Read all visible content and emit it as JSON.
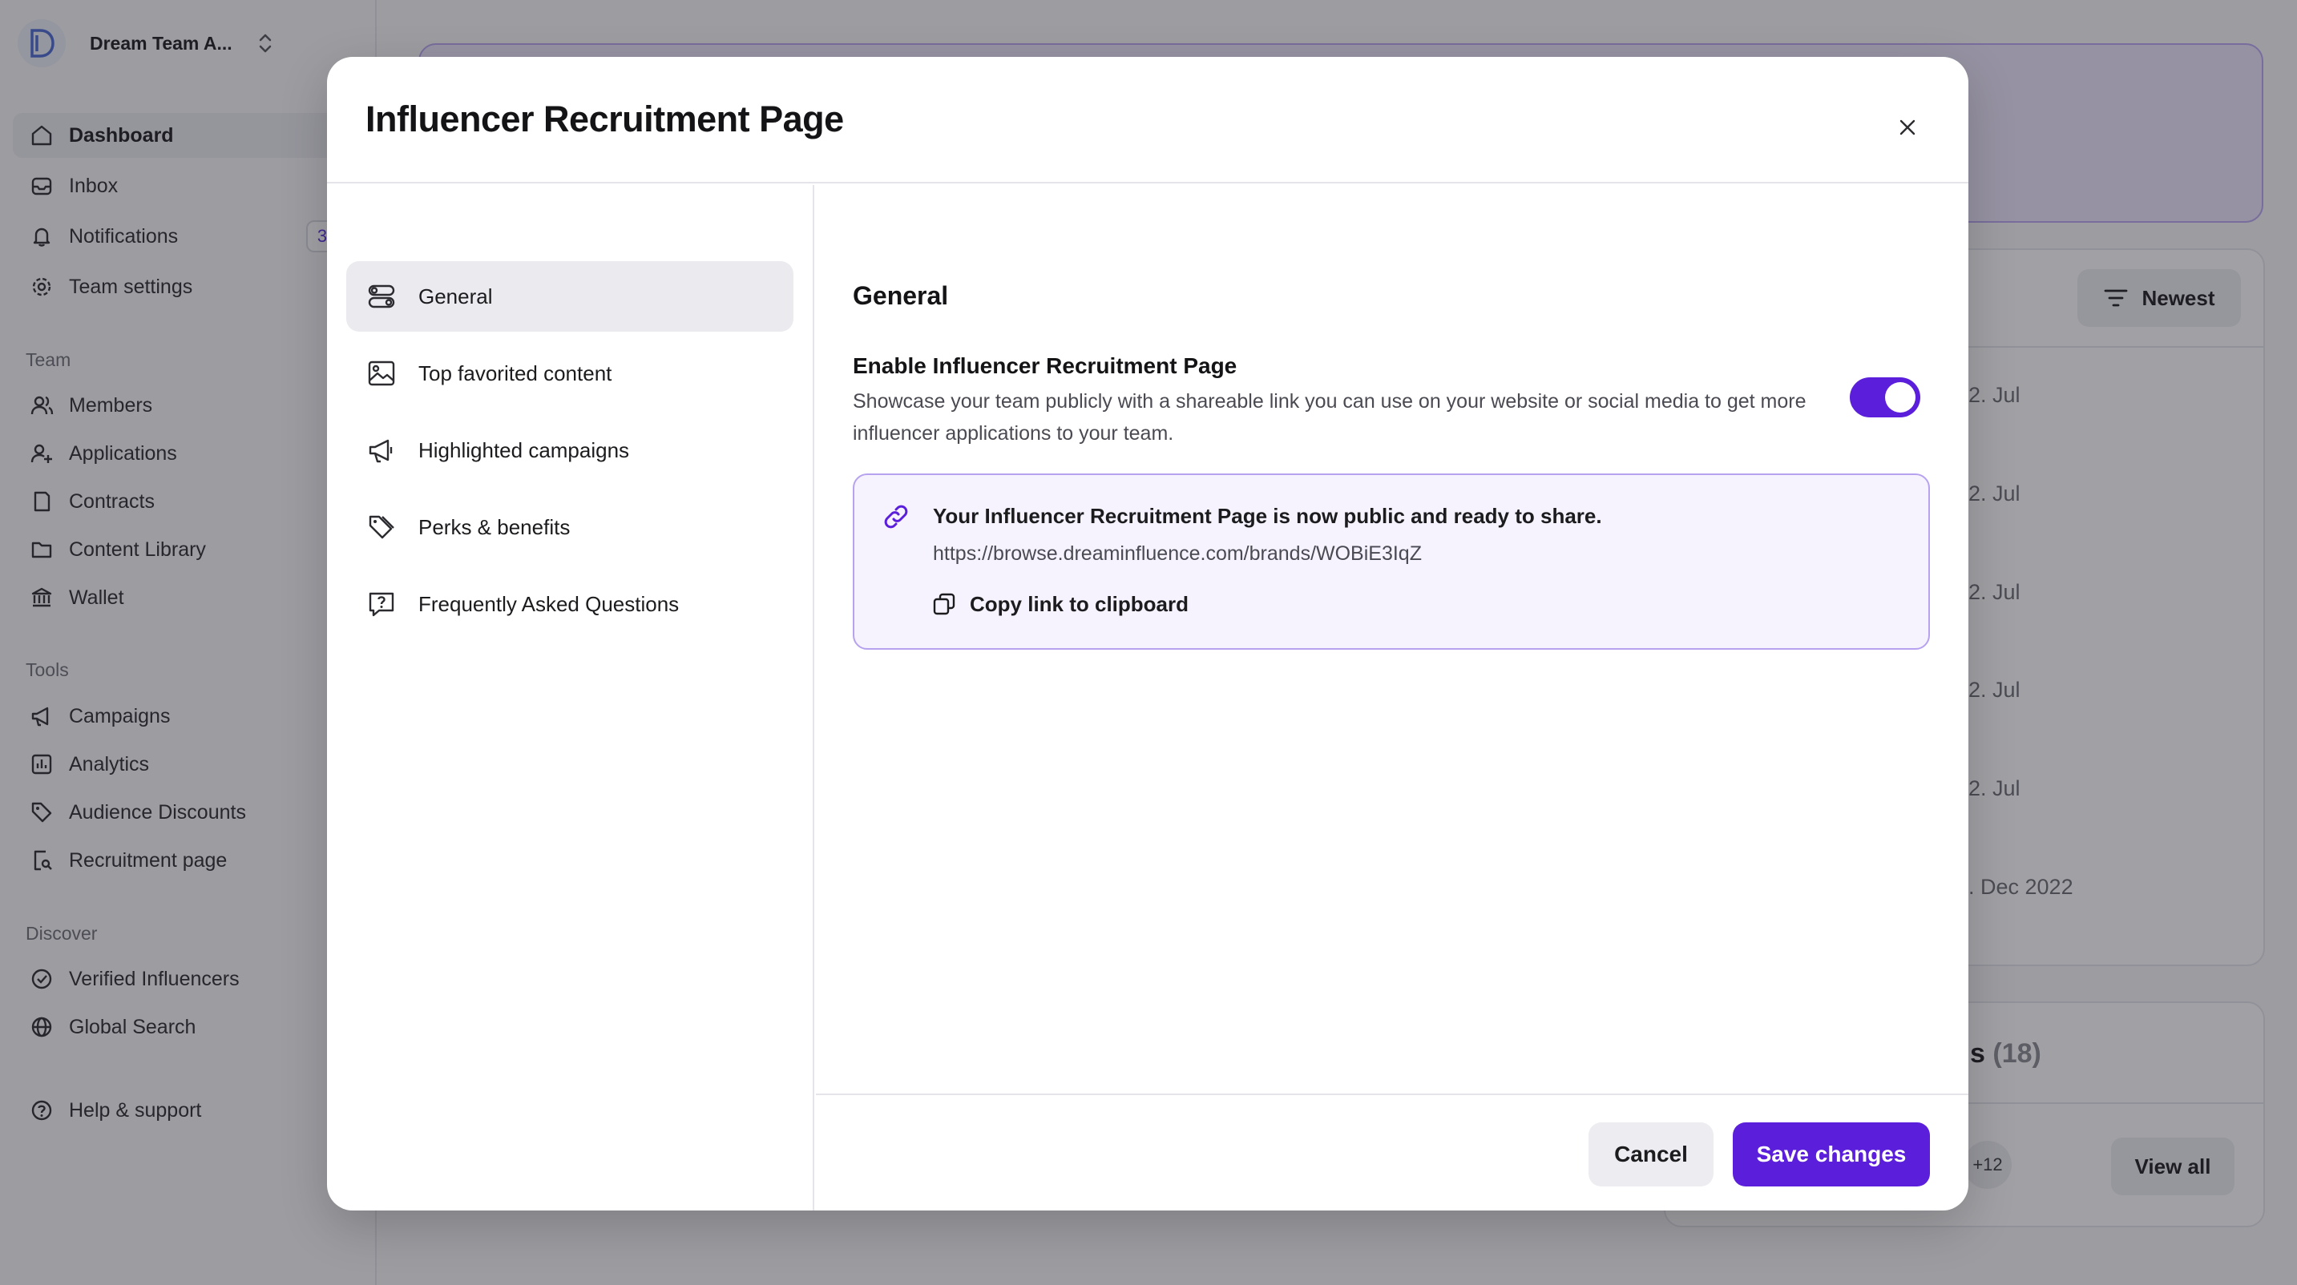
{
  "sidebar": {
    "team_name": "Dream Team A...",
    "team_logo_letter": "D",
    "nav": [
      {
        "label": "Dashboard",
        "icon": "home-icon",
        "active": true
      },
      {
        "label": "Inbox",
        "icon": "inbox-icon"
      },
      {
        "label": "Notifications",
        "icon": "bell-icon",
        "badge": "3"
      },
      {
        "label": "Team settings",
        "icon": "gear-icon"
      }
    ],
    "team_section": "Team",
    "team_items": [
      {
        "label": "Members",
        "icon": "users-icon"
      },
      {
        "label": "Applications",
        "icon": "user-add-icon"
      },
      {
        "label": "Contracts",
        "icon": "document-icon"
      },
      {
        "label": "Content Library",
        "icon": "folder-icon"
      },
      {
        "label": "Wallet",
        "icon": "bank-icon"
      }
    ],
    "tools_section": "Tools",
    "tools_items": [
      {
        "label": "Campaigns",
        "icon": "megaphone-icon"
      },
      {
        "label": "Analytics",
        "icon": "chart-icon"
      },
      {
        "label": "Audience Discounts",
        "icon": "tag-icon"
      },
      {
        "label": "Recruitment page",
        "icon": "page-search-icon"
      }
    ],
    "discover_section": "Discover",
    "discover_items": [
      {
        "label": "Verified Influencers",
        "icon": "check-circle-icon"
      },
      {
        "label": "Global Search",
        "icon": "globe-icon"
      }
    ],
    "help": {
      "label": "Help & support",
      "icon": "help-circle-icon"
    }
  },
  "background": {
    "sort_label": "Newest",
    "dates": [
      "2. Jul",
      "2. Jul",
      "2. Jul",
      "2. Jul",
      "2. Jul",
      ". Dec 2022"
    ],
    "card2_title_suffix": "s",
    "card2_count": "(18)",
    "more_count": "+12",
    "view_all_label": "View all"
  },
  "modal": {
    "title": "Influencer Recruitment Page",
    "nav": [
      {
        "label": "General",
        "icon": "toggles-icon",
        "active": true
      },
      {
        "label": "Top favorited content",
        "icon": "image-icon"
      },
      {
        "label": "Highlighted campaigns",
        "icon": "megaphone-icon"
      },
      {
        "label": "Perks & benefits",
        "icon": "tags-icon"
      },
      {
        "label": "Frequently Asked Questions",
        "icon": "question-bubble-icon"
      }
    ],
    "section_title": "General",
    "setting": {
      "title": "Enable Influencer Recruitment Page",
      "description": "Showcase your team publicly with a shareable link you can use on your website or social media to get more influencer applications to your team.",
      "enabled": true
    },
    "share": {
      "message": "Your Influencer Recruitment Page is now public and ready to share.",
      "url": "https://browse.dreaminfluence.com/brands/WOBiE3IqZ",
      "copy_label": "Copy link to clipboard"
    },
    "cancel_label": "Cancel",
    "save_label": "Save changes"
  },
  "colors": {
    "accent": "#5b1fdc",
    "share_bg": "#f6f3fe",
    "share_border": "#b7a2f0",
    "overlay": "rgba(30,30,40,0.42)"
  }
}
